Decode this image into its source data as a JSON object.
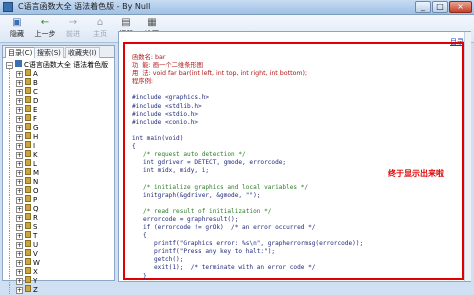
{
  "window": {
    "title": "C语言函数大全 语法着色版 - By Null",
    "min_label": "_",
    "max_label": "□",
    "close_label": "×"
  },
  "toolbar": {
    "buttons": [
      {
        "label": "隐藏",
        "icon": "hide-panel-icon",
        "glyph": "▣",
        "enabled": true
      },
      {
        "label": "上一步",
        "icon": "back-icon",
        "glyph": "←",
        "enabled": true
      },
      {
        "label": "前进",
        "icon": "forward-icon",
        "glyph": "→",
        "enabled": false
      },
      {
        "label": "主页",
        "icon": "home-icon",
        "glyph": "⌂",
        "enabled": false
      },
      {
        "label": "打印",
        "icon": "print-icon",
        "glyph": "▤",
        "enabled": true
      },
      {
        "label": "选项",
        "icon": "options-icon",
        "glyph": "▦",
        "enabled": true
      }
    ]
  },
  "left_panel": {
    "tabs": [
      {
        "label": "目录(C)",
        "active": true
      },
      {
        "label": "搜索(S)",
        "active": false
      },
      {
        "label": "收藏夹(I)",
        "active": false
      }
    ],
    "tree_root": "C语言函数大全 语法着色版",
    "tree_items": [
      "A",
      "B",
      "C",
      "D",
      "E",
      "F",
      "G",
      "H",
      "I",
      "K",
      "L",
      "M",
      "N",
      "O",
      "P",
      "Q",
      "R",
      "S",
      "T",
      "U",
      "V",
      "W",
      "X",
      "Y",
      "Z"
    ]
  },
  "content": {
    "toc_link": "目录",
    "code_lines": [
      {
        "text": "函数名: bar",
        "style": "cn"
      },
      {
        "text": "功  能: 画一个二维条形图",
        "style": "cn"
      },
      {
        "text": "用  法: void far bar(int left, int top, int right, int bottom);",
        "style": "cn"
      },
      {
        "text": "程序例:",
        "style": "cn"
      },
      {
        "text": "",
        "style": "code"
      },
      {
        "text": "#include <graphics.h>",
        "style": "code"
      },
      {
        "text": "#include <stdlib.h>",
        "style": "code"
      },
      {
        "text": "#include <stdio.h>",
        "style": "code"
      },
      {
        "text": "#include <conio.h>",
        "style": "code"
      },
      {
        "text": "",
        "style": "code"
      },
      {
        "text": "int main(void)",
        "style": "code"
      },
      {
        "text": "{",
        "style": "code"
      },
      {
        "text": "   /* request auto detection */",
        "style": "cm"
      },
      {
        "text": "   int gdriver = DETECT, gmode, errorcode;",
        "style": "code"
      },
      {
        "text": "   int midx, midy, i;",
        "style": "code"
      },
      {
        "text": "",
        "style": "code"
      },
      {
        "text": "   /* initialize graphics and local variables */",
        "style": "cm"
      },
      {
        "text": "   initgraph(&gdriver, &gmode, \"\");",
        "style": "code"
      },
      {
        "text": "",
        "style": "code"
      },
      {
        "text": "   /* read result of initialization */",
        "style": "cm"
      },
      {
        "text": "   errorcode = graphresult();",
        "style": "code"
      },
      {
        "text": "   if (errorcode != grOk)  /* an error occurred */",
        "style": "code"
      },
      {
        "text": "   {",
        "style": "code"
      },
      {
        "text": "      printf(\"Graphics error: %s\\n\", grapherrormsg(errorcode));",
        "style": "code"
      },
      {
        "text": "      printf(\"Press any key to halt:\");",
        "style": "code"
      },
      {
        "text": "      getch();",
        "style": "code"
      },
      {
        "text": "      exit(1);  /* terminate with an error code */",
        "style": "code"
      },
      {
        "text": "   }",
        "style": "code"
      }
    ],
    "annotation": "终于显示出来啦"
  }
}
